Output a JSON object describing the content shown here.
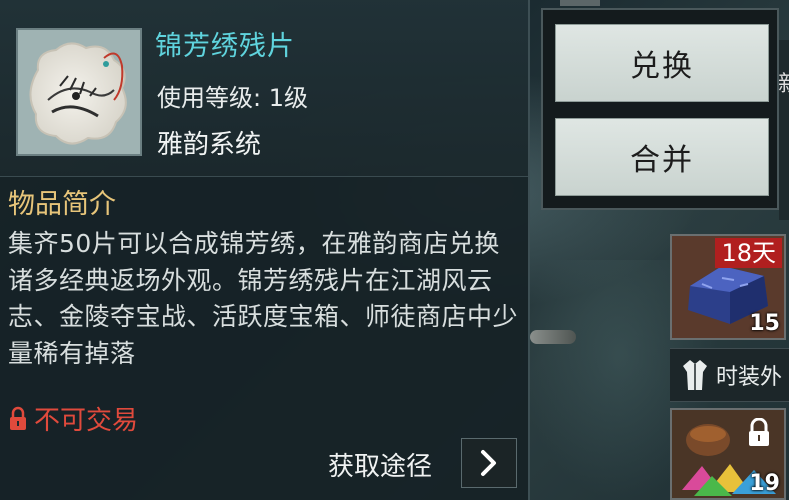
{
  "item": {
    "name": "锦芳绣残片",
    "level": "使用等级: 1级",
    "system": "雅韵系统"
  },
  "description": {
    "title": "物品简介",
    "text": "集齐50片可以合成锦芳绣，在雅韵商店兑换诸多经典返场外观。锦芳绣残片在江湖风云志、金陵夺宝战、活跃度宝箱、师徒商店中少量稀有掉落"
  },
  "trade_status": "不可交易",
  "source": {
    "label": "获取途径"
  },
  "actions": {
    "exchange_label": "兑换",
    "merge_label": "合并"
  },
  "inventory": {
    "slot1": {
      "badge": "18天",
      "count": "15"
    },
    "fashion_label": "时装外",
    "slot2": {
      "count": "19"
    },
    "edge_char": "新"
  },
  "colors": {
    "item_name": "#5fd3dd",
    "section_title": "#e7c57a",
    "trade_warning": "#e04a3c",
    "days_badge": "#b11f1f"
  },
  "icons": {
    "item": "embroidery-fragment-icon",
    "trade": "lock-icon",
    "source_arrow": "chevron-right-icon",
    "fashion": "robe-icon",
    "slot_lock": "lock-icon"
  }
}
